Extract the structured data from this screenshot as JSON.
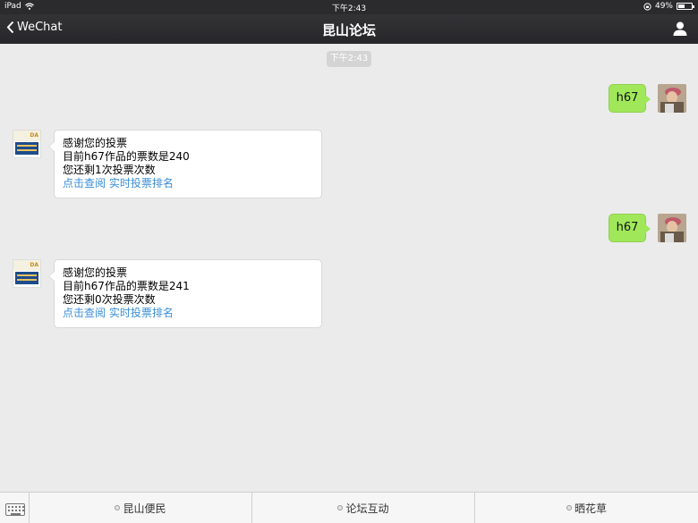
{
  "status_bar": {
    "device": "iPad",
    "time": "下午2:43",
    "battery": "49%",
    "battery_level": 0.49
  },
  "nav": {
    "back_label": "WeChat",
    "title": "昆山论坛"
  },
  "time_pill": "下午2:43",
  "bot_avatar_text": "DA",
  "messages": [
    {
      "from": "me",
      "text": "h67"
    },
    {
      "from": "bot",
      "lines": [
        "感谢您的投票",
        "目前h67作品的票数是240",
        "您还剩1次投票次数"
      ],
      "links": [
        "点击查阅",
        "实时投票排名"
      ]
    },
    {
      "from": "me",
      "text": "h67"
    },
    {
      "from": "bot",
      "lines": [
        "感谢您的投票",
        "目前h67作品的票数是241",
        "您还剩0次投票次数"
      ],
      "links": [
        "点击查阅",
        "实时投票排名"
      ]
    }
  ],
  "bottom_menu": [
    {
      "label": "昆山便民"
    },
    {
      "label": "论坛互动"
    },
    {
      "label": "晒花草"
    }
  ],
  "colors": {
    "nav_bg": "#2b2b2d",
    "chat_bg": "#ebebeb",
    "outgoing_bubble": "#a0e75a",
    "link": "#3a8ed8"
  }
}
